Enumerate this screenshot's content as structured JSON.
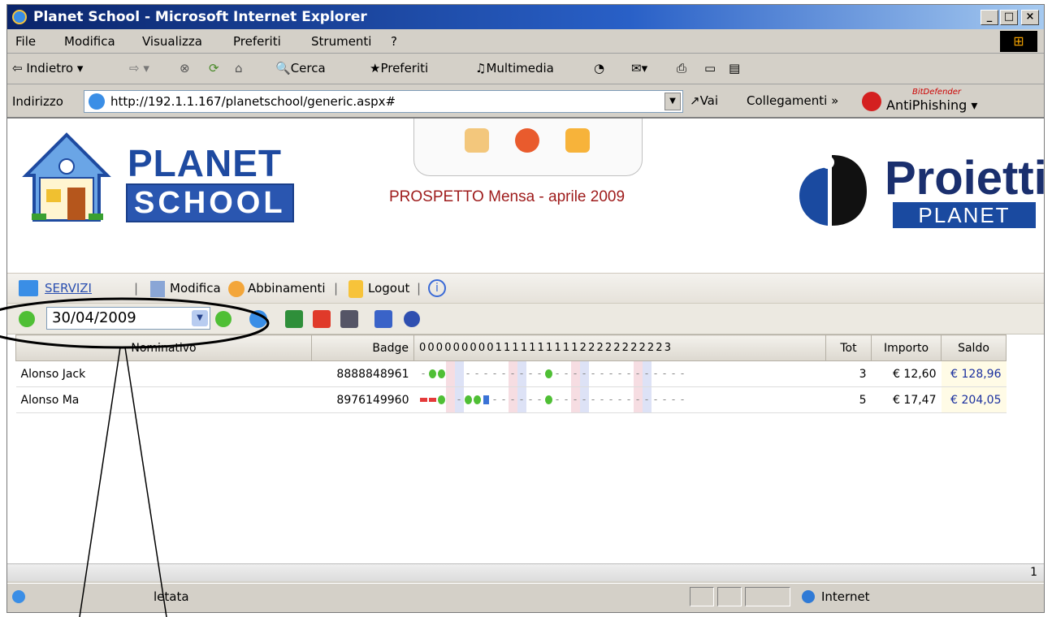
{
  "window": {
    "title": "Planet School - Microsoft Internet Explorer"
  },
  "menu": [
    "File",
    "Modifica",
    "Visualizza",
    "Preferiti",
    "Strumenti",
    "?"
  ],
  "toolbar": {
    "back": "Indietro",
    "search": "Cerca",
    "favorites": "Preferiti",
    "media": "Multimedia"
  },
  "address": {
    "label": "Indirizzo",
    "url": "http://192.1.1.167/planetschool/generic.aspx#",
    "go": "Vai",
    "links": "Collegamenti",
    "antiphishing_brand": "BitDefender",
    "antiphishing": "AntiPhishing"
  },
  "banner": {
    "logo_top": "PLANET",
    "logo_bottom": "SCHOOL",
    "page_title": "PROSPETTO Mensa - aprile 2009",
    "brand": "Proietti",
    "brand_sub": "PLANET"
  },
  "services": {
    "servizi": "SERVIZI",
    "modifica": "Modifica",
    "abbinamenti": "Abbinamenti",
    "logout": "Logout"
  },
  "date_filter": {
    "value": "30/04/2009"
  },
  "table": {
    "headers": {
      "name": "Nominativo",
      "badge": "Badge",
      "days": "0 0 0 0 0 0 0 0 0 1 1 1 1 1 1 1 1 1 1 2 2 2 2 2 2 2 2 2 2 3",
      "tot": "Tot",
      "importo": "Importo",
      "saldo": "Saldo"
    },
    "rows": [
      {
        "name": "Alonso Jack",
        "badge": "8888848961",
        "tot": "3",
        "importo": "€ 12,60",
        "saldo": "€ 128,96"
      },
      {
        "name": "Alonso Ma",
        "badge": "8976149960",
        "tot": "5",
        "importo": "€ 17,47",
        "saldo": "€ 204,05"
      }
    ]
  },
  "pager": {
    "page": "1"
  },
  "status": {
    "text": "letata",
    "zone": "Internet"
  }
}
